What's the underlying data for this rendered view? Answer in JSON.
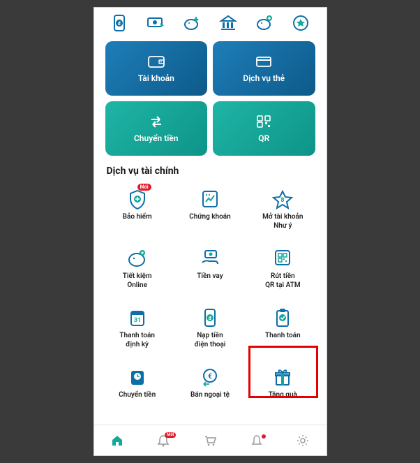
{
  "colors": {
    "primary": "#0d6fa8",
    "teal": "#14a89a",
    "highlight": "#e60000",
    "badge": "#e11b2b",
    "icon_grey": "#9a9a9a"
  },
  "top_nav": {
    "items": [
      {
        "icon": "phone-d-icon"
      },
      {
        "icon": "transfer-icon"
      },
      {
        "icon": "piggy-down-icon"
      },
      {
        "icon": "bank-icon"
      },
      {
        "icon": "piggy-plus-icon"
      },
      {
        "icon": "rewards-icon"
      }
    ]
  },
  "main_cards": [
    {
      "label": "Tài khoản",
      "icon": "wallet-icon",
      "style": "blue"
    },
    {
      "label": "Dịch vụ thẻ",
      "icon": "card-icon",
      "style": "blue"
    },
    {
      "label": "Chuyển tiền",
      "icon": "transfer-arrows-icon",
      "style": "teal"
    },
    {
      "label": "QR",
      "icon": "qr-icon",
      "style": "teal"
    }
  ],
  "section": {
    "title": "Dịch vụ tài chính"
  },
  "services": [
    {
      "label": "Bảo hiểm",
      "icon": "shield-plus-icon",
      "badge": "Mới"
    },
    {
      "label": "Chứng khoán",
      "icon": "stocks-icon"
    },
    {
      "label": "Mở tài khoản\nNhư ý",
      "icon": "star-icon"
    },
    {
      "label": "Tiết kiệm\nOnline",
      "icon": "piggy-save-icon"
    },
    {
      "label": "Tiền vay",
      "icon": "loan-hand-icon"
    },
    {
      "label": "Rút tiền\nQR tại ATM",
      "icon": "qr-atm-icon"
    },
    {
      "label": "Thanh toán\nđịnh kỳ",
      "icon": "calendar-icon"
    },
    {
      "label": "Nạp tiền\nđiện thoại",
      "icon": "phone-topup-icon"
    },
    {
      "label": "Thanh toán",
      "icon": "clipboard-check-icon",
      "highlighted": true
    },
    {
      "label": "Chuyển tiền",
      "icon": "clock-money-icon"
    },
    {
      "label": "Bán ngoại tệ",
      "icon": "euro-exchange-icon"
    },
    {
      "label": "Tặng quà",
      "icon": "gift-icon"
    }
  ],
  "bottom_nav": {
    "items": [
      {
        "icon": "home-icon",
        "active": true
      },
      {
        "icon": "bell-icon",
        "badge": "Mới"
      },
      {
        "icon": "cart-icon"
      },
      {
        "icon": "notification-icon",
        "dot": true
      },
      {
        "icon": "settings-icon"
      }
    ]
  }
}
